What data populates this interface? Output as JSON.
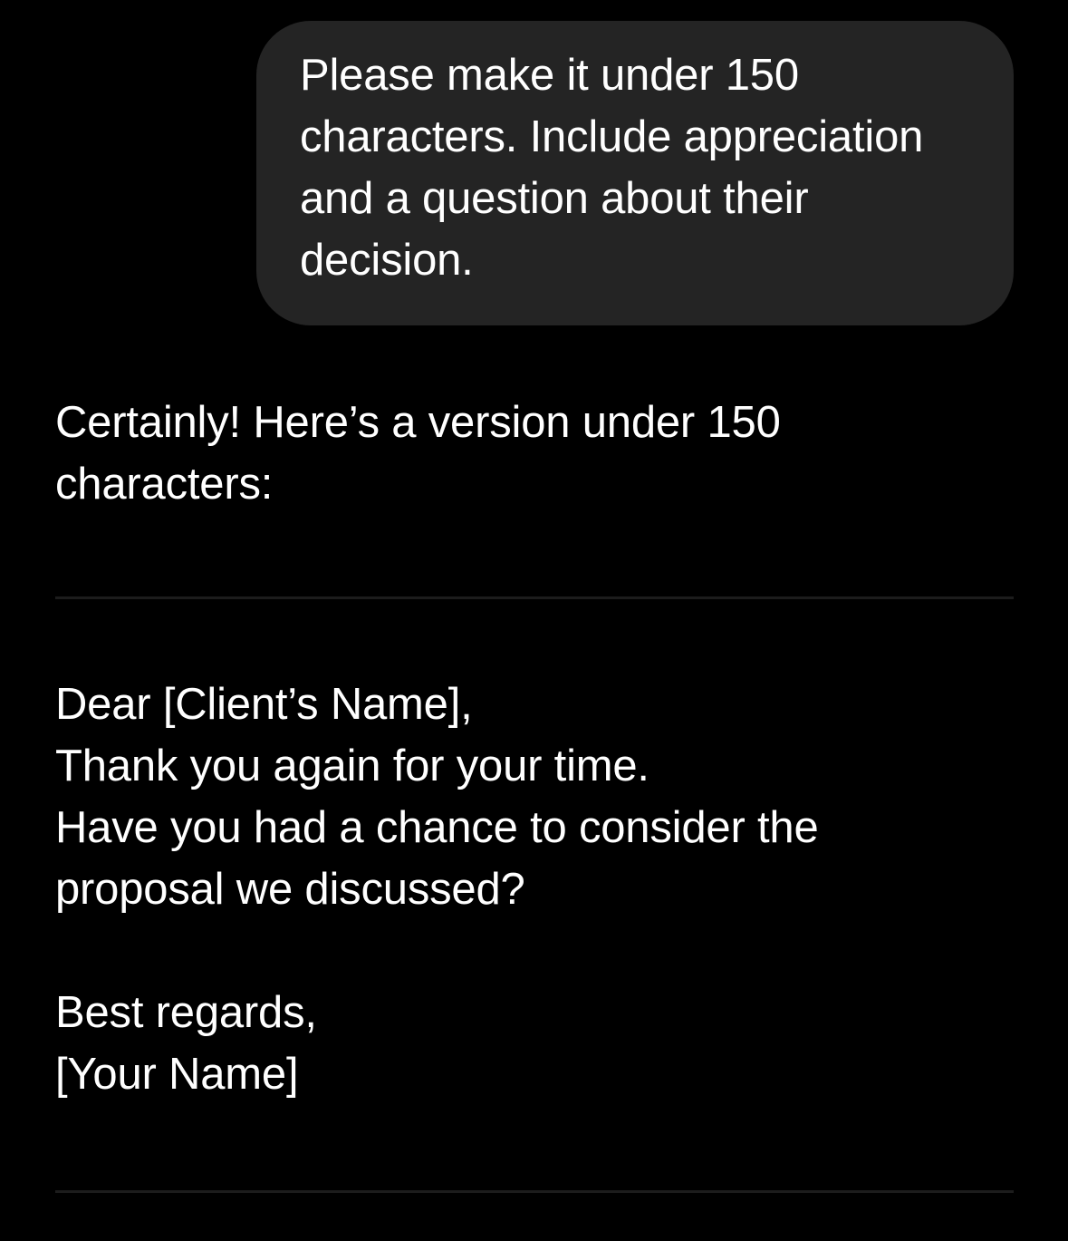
{
  "colors": {
    "background": "#000000",
    "user_bubble": "#242424",
    "text": "#ffffff",
    "divider": "#1c1c1c"
  },
  "user_message": {
    "text": "Please make it under 150 characters. Include appreciation and a question about their decision."
  },
  "assistant": {
    "intro": "Certainly! Here’s a version under 150 characters:",
    "letter": {
      "greeting": "Dear [Client’s Name],",
      "thanks": "Thank you again for your time.",
      "question": "Have you had a chance to consider the proposal we discussed?",
      "closing": "Best regards,",
      "signature": "[Your Name]"
    }
  }
}
